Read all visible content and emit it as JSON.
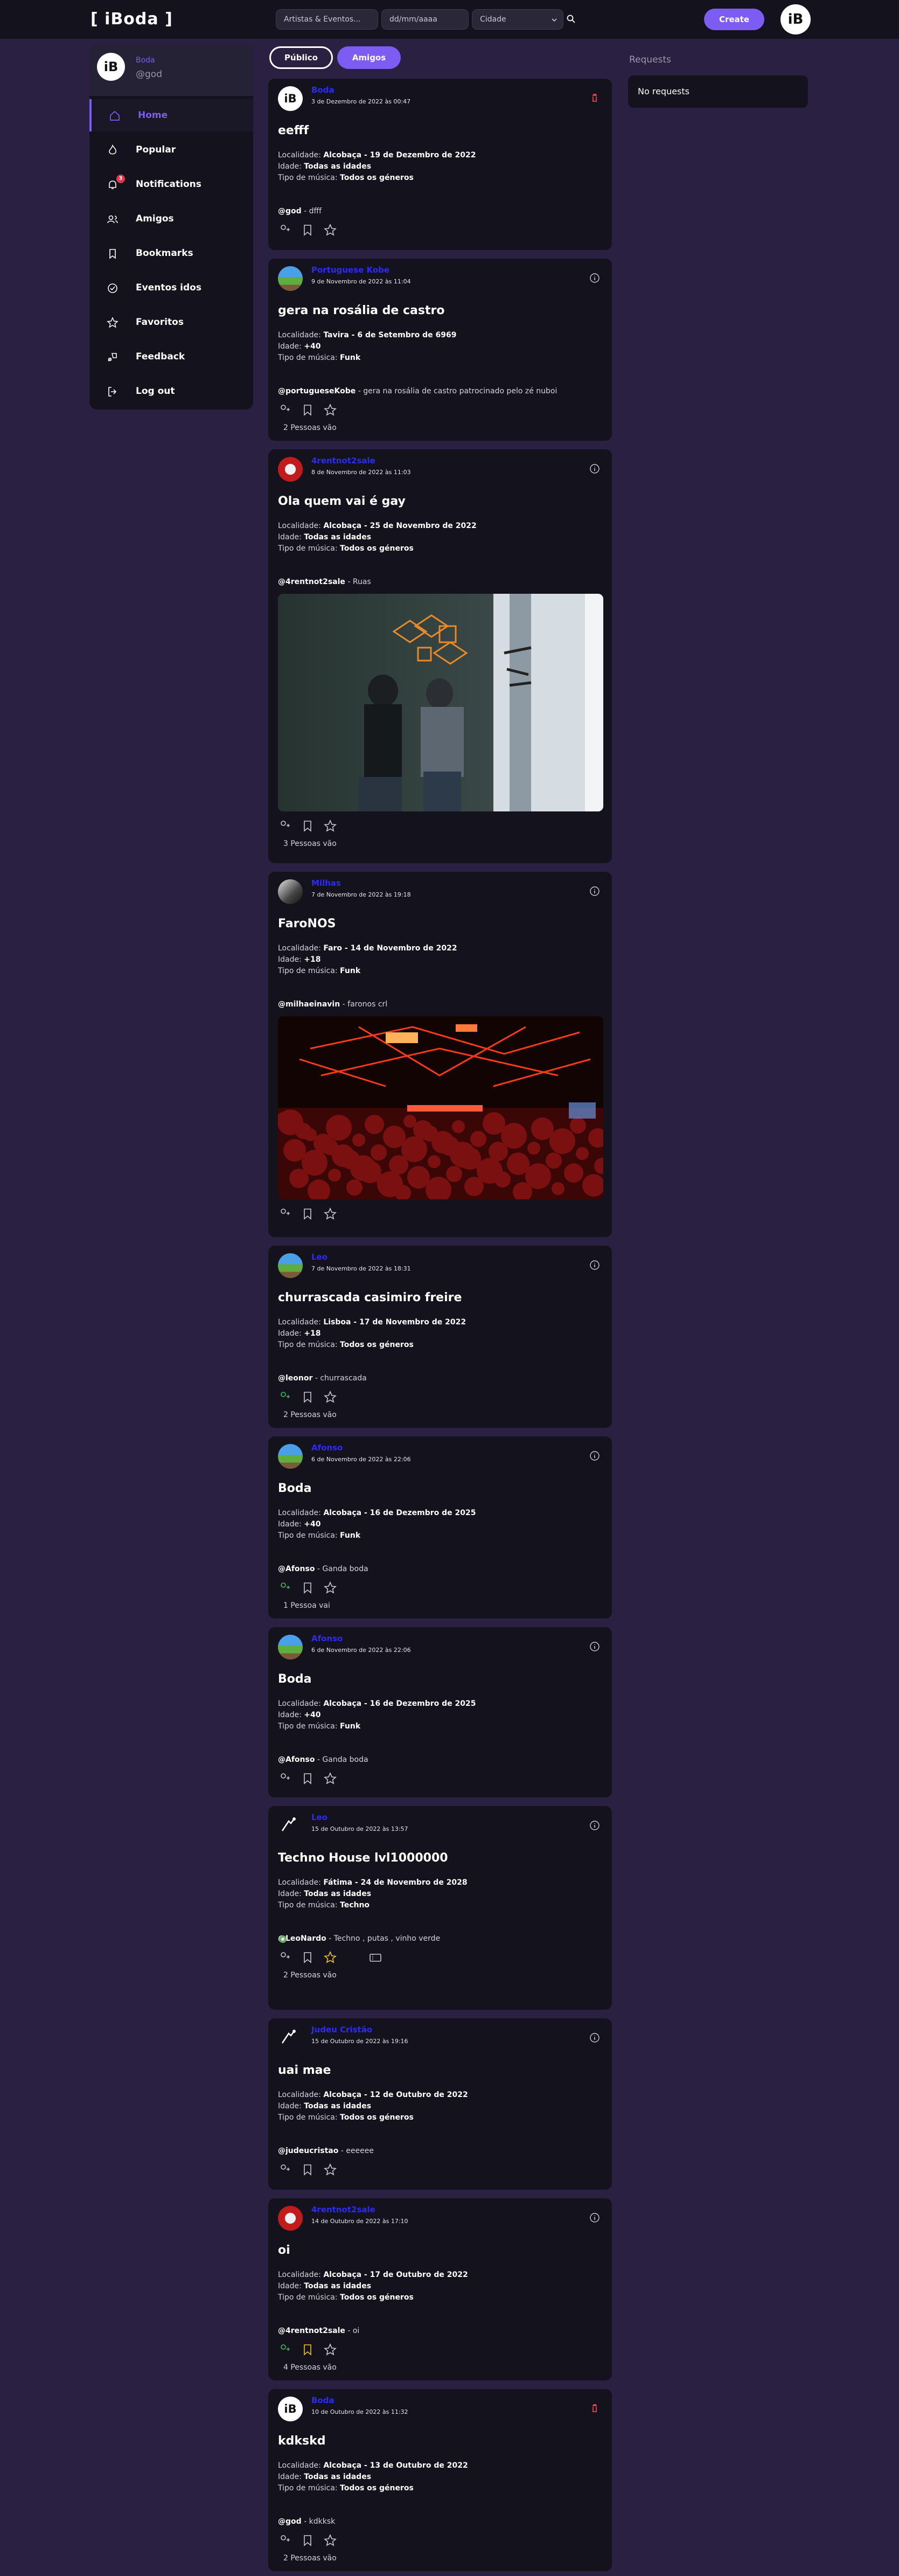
{
  "topbar": {
    "logo": "[ iBoda ]",
    "search_artists_placeholder": "Artistas & Eventos...",
    "date_placeholder": "dd/mm/aaaa",
    "city_label": "Cidade",
    "create_label": "Create",
    "avatar_text": "iB"
  },
  "sidebar": {
    "profile": {
      "name": "Boda",
      "handle": "@god",
      "avatar_text": "iB"
    },
    "items": [
      {
        "label": "Home",
        "icon": "home-icon"
      },
      {
        "label": "Popular",
        "icon": "flame-icon"
      },
      {
        "label": "Notifications",
        "icon": "bell-icon",
        "badge": "3"
      },
      {
        "label": "Amigos",
        "icon": "users-icon"
      },
      {
        "label": "Bookmarks",
        "icon": "bookmark-icon"
      },
      {
        "label": "Eventos idos",
        "icon": "check-circle-icon"
      },
      {
        "label": "Favoritos",
        "icon": "star-icon"
      },
      {
        "label": "Feedback",
        "icon": "feedback-icon"
      },
      {
        "label": "Log out",
        "icon": "logout-icon"
      }
    ]
  },
  "tabs": {
    "public": "Público",
    "friends": "Amigos"
  },
  "requests": {
    "title": "Requests",
    "empty": "No requests"
  },
  "labels": {
    "localidade": "Localidade:",
    "idade": "Idade:",
    "tipo": "Tipo de música:"
  },
  "posts": [
    {
      "name": "Boda",
      "date": "3 de Dezembro de 2022 às 00:47",
      "title": "eefff",
      "place": "Alcobaça - 19 de Dezembro de 2022",
      "age": "Todas as idades",
      "genre": "Todos os géneros",
      "handle": "@god",
      "caption": " - dfff",
      "going": ""
    },
    {
      "name": "Portuguese Kobe",
      "date": "9 de Novembro de 2022 às 11:04",
      "title": "gera na rosália de castro",
      "place": "Tavira - 6 de Setembro de 6969",
      "age": "+40",
      "genre": "Funk",
      "handle": "@portugueseKobe",
      "caption": " - gera na rosália de castro patrocinado pelo zé nuboi",
      "going": "2 Pessoas vão"
    },
    {
      "name": "4rentnot2sale",
      "date": "8 de Novembro de 2022 às 11:03",
      "title": "Ola quem vai é gay",
      "place": "Alcobaça - 25 de Novembro de 2022",
      "age": "Todas as idades",
      "genre": "Todos os géneros",
      "handle": "@4rentnot2sale",
      "caption": " - Ruas",
      "going": "3 Pessoas vão"
    },
    {
      "name": "Milhas",
      "date": "7 de Novembro de 2022 às 19:18",
      "title": "FaroNOS",
      "place": "Faro - 14 de Novembro de 2022",
      "age": "+18",
      "genre": "Funk",
      "handle": "@milhaeinavin",
      "caption": " - faronos crl",
      "going": ""
    },
    {
      "name": "Leo",
      "date": "7 de Novembro de 2022 às 18:31",
      "title": "churrascada casimiro freire",
      "place": "Lisboa - 17 de Novembro de 2022",
      "age": "+18",
      "genre": "Todos os géneros",
      "handle": "@leonor",
      "caption": " - churrascada",
      "going": "2 Pessoas vão"
    },
    {
      "name": "Afonso",
      "date": "6 de Novembro de 2022 às 22:06",
      "title": "Boda",
      "place": "Alcobaça - 16 de Dezembro de 2025",
      "age": "+40",
      "genre": "Funk",
      "handle": "@Afonso",
      "caption": " - Ganda boda",
      "going": "1 Pessoa vai"
    },
    {
      "name": "Afonso",
      "date": "6 de Novembro de 2022 às 22:06",
      "title": "Boda",
      "place": "Alcobaça - 16 de Dezembro de 2025",
      "age": "+40",
      "genre": "Funk",
      "handle": "@Afonso",
      "caption": " - Ganda boda",
      "going": ""
    },
    {
      "name": "Leo",
      "date": "15 de Outubro de 2022 às 13:57",
      "title": "Techno House lvl1000000",
      "place": "Fátima - 24 de Novembro de 2028",
      "age": "Todas as idades",
      "genre": "Techno",
      "handle": "@LeoNardo",
      "caption": " - Techno , putas , vinho verde",
      "going": "2 Pessoas vão"
    },
    {
      "name": "Judeu Cristão",
      "date": "15 de Outubro de 2022 às 19:16",
      "title": "uai mae",
      "place": "Alcobaça - 12 de Outubro de 2022",
      "age": "Todas as idades",
      "genre": "Todos os géneros",
      "handle": "@judeucristao",
      "caption": " - eeeeee",
      "going": ""
    },
    {
      "name": "4rentnot2sale",
      "date": "14 de Outubro de 2022 às 17:10",
      "title": "oi",
      "place": "Alcobaça - 17 de Outubro de 2022",
      "age": "Todas as idades",
      "genre": "Todos os géneros",
      "handle": "@4rentnot2sale",
      "caption": " - oi",
      "going": "4 Pessoas vão"
    },
    {
      "name": "Boda",
      "date": "10 de Outubro de 2022 às 11:32",
      "title": "kdkskd",
      "place": "Alcobaça - 13 de Outubro de 2022",
      "age": "Todas as idades",
      "genre": "Todos os géneros",
      "handle": "@god",
      "caption": " - kdkksk",
      "going": "2 Pessoas vão"
    }
  ],
  "colors": {
    "accent": "#7c5cf2",
    "card": "#14121c",
    "bg": "#2a2142",
    "danger": "#e0384b",
    "going_green": "#3fbf5a",
    "favorite_yellow": "#f0c419",
    "bookmark_yellow": "#f0c419"
  }
}
